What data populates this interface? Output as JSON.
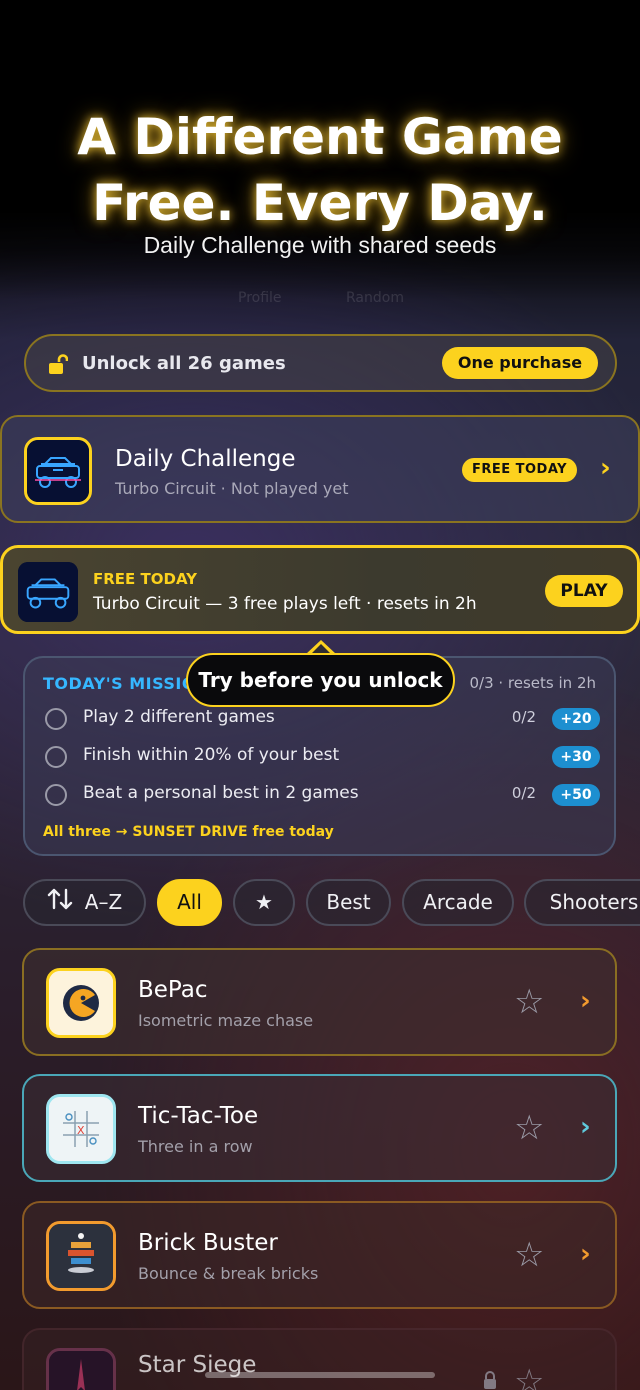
{
  "hero": {
    "title_line1": "A Different Game",
    "title_line2": "Free. Every Day.",
    "subtitle": "Daily Challenge with shared seeds"
  },
  "ghost_tabs": [
    "Profile",
    "Random"
  ],
  "unlock_banner": {
    "icon": "lock-open-icon",
    "label": "Unlock all 26 games",
    "cta": "One purchase"
  },
  "daily_challenge": {
    "title": "Daily Challenge",
    "subtitle": "Turbo Circuit · Not played yet",
    "badge": "FREE TODAY",
    "icon": "race-car-icon"
  },
  "free_today_bar": {
    "kicker": "FREE TODAY",
    "line": "Turbo Circuit — 3 free plays left · resets in 2h",
    "play": "PLAY"
  },
  "tooltip": "Try before you unlock",
  "missions": {
    "heading": "TODAY'S MISSIONS",
    "heading_visible": "TODAY'S MISSIO",
    "resets": "0/3 · resets in 2h",
    "items": [
      {
        "text": "Play 2 different games",
        "progress": "0/2",
        "points": "+20"
      },
      {
        "text": "Finish within 20% of your best",
        "progress": "",
        "points": "+30"
      },
      {
        "text": "Beat a personal best in 2 games",
        "progress": "0/2",
        "points": "+50"
      }
    ],
    "footer": "All three → SUNSET DRIVE free today"
  },
  "filters": {
    "sort": "A–Z",
    "chips": [
      "All",
      "★",
      "Best",
      "Arcade",
      "Shooters"
    ],
    "active": "All"
  },
  "games": [
    {
      "name": "BePac",
      "subtitle": "Isometric maze chase",
      "accent": "#fcd21e",
      "locked": false
    },
    {
      "name": "Tic-Tac-Toe",
      "subtitle": "Three in a row",
      "accent": "#5fc9dc",
      "locked": false
    },
    {
      "name": "Brick Buster",
      "subtitle": "Bounce & break bricks",
      "accent": "#f29b2e",
      "locked": false
    },
    {
      "name": "Star Siege",
      "subtitle": "",
      "accent": "#7a3a4a",
      "locked": true
    }
  ],
  "colors": {
    "accent": "#fcd21e",
    "mission_blue": "#36b7ff",
    "points_pill": "#1d8fd0"
  }
}
